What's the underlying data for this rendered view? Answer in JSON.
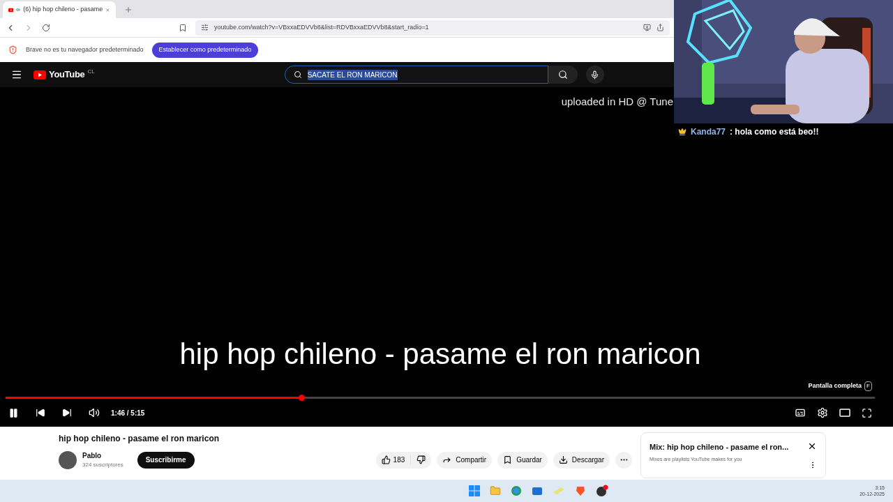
{
  "browser": {
    "tab": {
      "title": "(6) hip hop chileno - pasame",
      "selected": true
    },
    "url": "youtube.com/watch?v=VBxxaEDVVb8&list=RDVBxxaEDVVb8&start_radio=1"
  },
  "infobar": {
    "message": "Brave no es tu navegador predeterminado",
    "button": "Establecer como predeterminado"
  },
  "youtube": {
    "logo": "YouTube",
    "region": "CL",
    "search": {
      "value": "SACATE EL RON MARICON"
    }
  },
  "player": {
    "overlay_title": "hip hop chileno - pasame el ron maricon",
    "overlay_credit": "uploaded in HD @ Tune",
    "tooltip": {
      "label": "Pantalla completa",
      "key": "F"
    },
    "progress": {
      "level": 0.34
    },
    "time": "1:46 / 5:15",
    "playing": true
  },
  "video": {
    "title": "hip hop chileno - pasame el ron maricon",
    "channel": "Pablo",
    "subscribers": "324 suscriptores",
    "subscribe": "Suscribirme",
    "likes": "183",
    "actions": [
      "Compartir",
      "Guardar",
      "Descargar"
    ]
  },
  "mix": {
    "title": "Mix: hip hop chileno - pasame el ron...",
    "subtitle": "Mixes are playlists YouTube makes for you"
  },
  "stream": {
    "chat": {
      "user": "Kanda77",
      "message": ": hola como está beo!!"
    }
  },
  "taskbar": {
    "time": "3:15",
    "date": "20-12-2025"
  }
}
